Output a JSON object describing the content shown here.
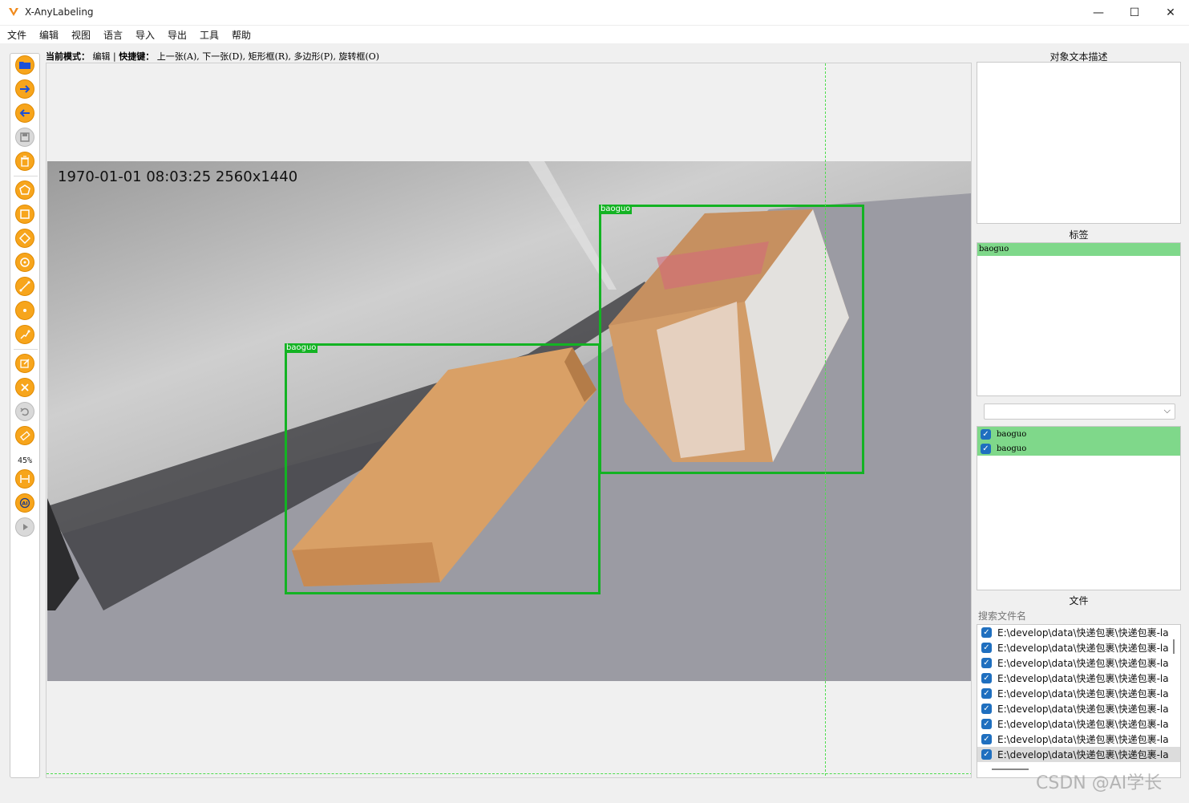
{
  "window": {
    "title": "X-AnyLabeling",
    "minimize_glyph": "—",
    "maximize_glyph": "☐",
    "close_glyph": "✕"
  },
  "menu": [
    "文件",
    "编辑",
    "视图",
    "语言",
    "导入",
    "导出",
    "工具",
    "帮助"
  ],
  "toolbar": {
    "zoom": "45%",
    "icons": [
      "open-folder-icon",
      "next-image-icon",
      "prev-image-icon",
      "save-icon",
      "delete-icon",
      "polygon-icon",
      "rectangle-icon",
      "rotated-rect-icon",
      "circle-icon",
      "line-icon",
      "point-icon",
      "linestrip-icon",
      "edit-icon",
      "delete-shape-icon",
      "undo-icon",
      "brightness-icon",
      "fit-width-icon",
      "ai-icon",
      "run-icon"
    ]
  },
  "mode_bar": {
    "mode_label": "当前模式：",
    "mode_value": "编辑",
    "separator": "|",
    "shortcut_label": "快捷键：",
    "shortcuts": "上一张(A), 下一张(D), 矩形框(R), 多边形(P), 旋转框(O)"
  },
  "canvas": {
    "osd_text": "1970-01-01  08:03:25  2560x1440",
    "boxes": [
      {
        "label": "baoguo"
      },
      {
        "label": "baoguo"
      }
    ]
  },
  "right_panel": {
    "description_title": "对象文本描述",
    "labels_title": "标签",
    "labels": [
      "baoguo"
    ],
    "shapes": [
      "baoguo",
      "baoguo"
    ],
    "files_title": "文件",
    "search_placeholder": "搜索文件名",
    "files": [
      "E:\\develop\\data\\快递包裹\\快递包裹-la",
      "E:\\develop\\data\\快递包裹\\快递包裹-la",
      "E:\\develop\\data\\快递包裹\\快递包裹-la",
      "E:\\develop\\data\\快递包裹\\快递包裹-la",
      "E:\\develop\\data\\快递包裹\\快递包裹-la",
      "E:\\develop\\data\\快递包裹\\快递包裹-la",
      "E:\\develop\\data\\快递包裹\\快递包裹-la",
      "E:\\develop\\data\\快递包裹\\快递包裹-la",
      "E:\\develop\\data\\快递包裹\\快递包裹-la"
    ]
  },
  "watermark": "CSDN @AI学长",
  "colors": {
    "accent": "#f7a51c",
    "box": "#13b323",
    "label_highlight": "#7fd88a",
    "checkbox": "#1f6fbf"
  }
}
